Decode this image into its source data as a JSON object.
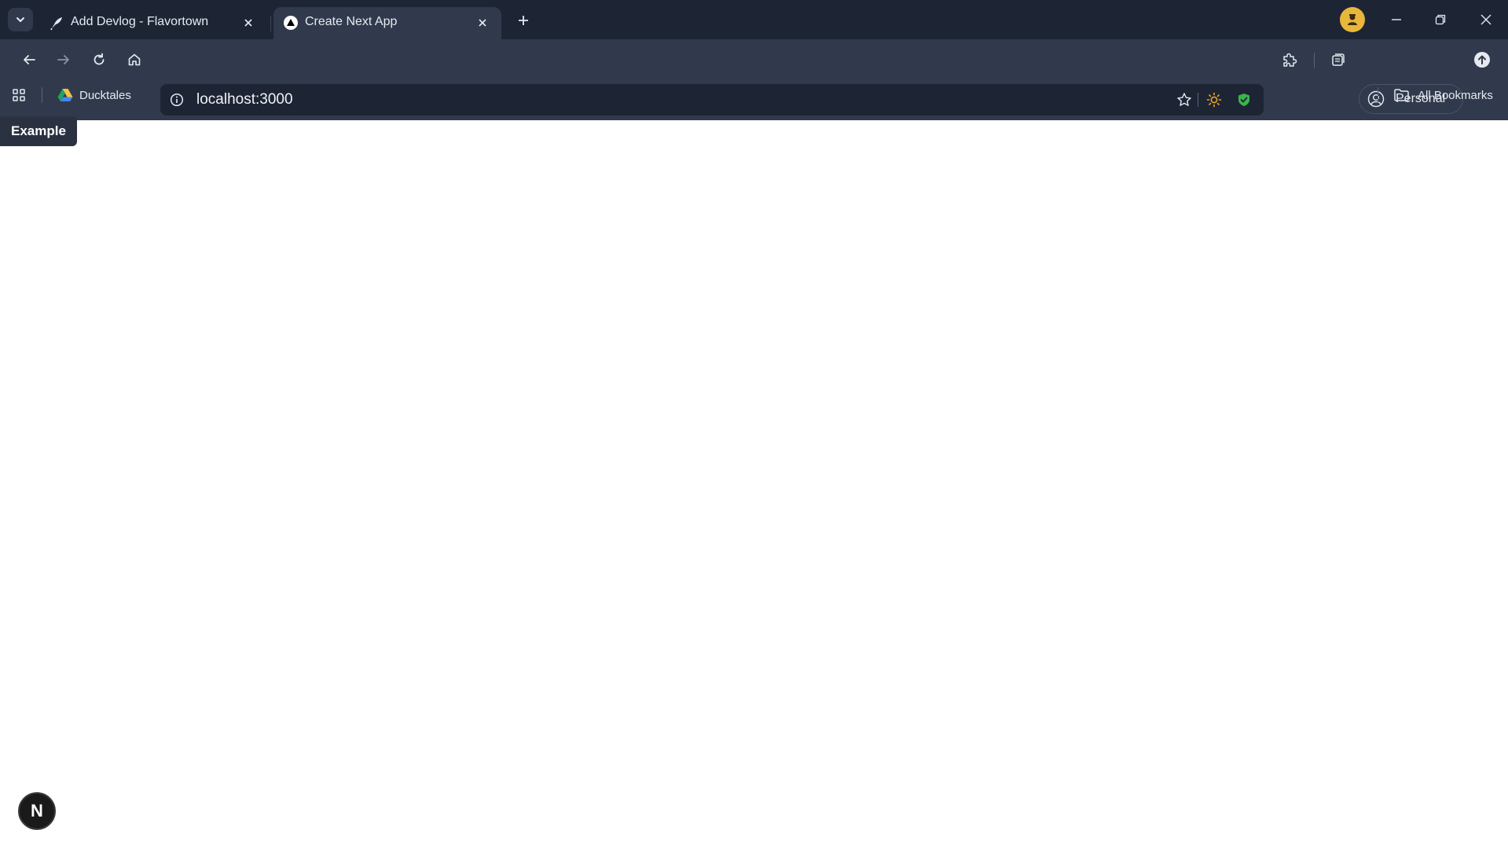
{
  "browser": {
    "tabs": [
      {
        "title": "Add Devlog - Flavortown",
        "active": false
      },
      {
        "title": "Create Next App",
        "active": true
      }
    ],
    "address_bar": {
      "url": "localhost:3000"
    },
    "bookmarks": [
      {
        "label": "Ducktales"
      }
    ],
    "all_bookmarks_label": "All Bookmarks",
    "profile": {
      "label": "Personal"
    }
  },
  "page": {
    "example_badge": "Example",
    "dev_indicator_letter": "N"
  },
  "colors": {
    "titlebar_bg": "#1d2535",
    "toolbar_bg": "#303a4c",
    "page_bg": "#ffffff",
    "shield_green": "#3bb54a",
    "sun_orange": "#f0a020"
  },
  "icons": [
    "tab-search-icon",
    "quill-icon",
    "next-logo-icon",
    "close-icon",
    "new-tab-icon",
    "avatar-icon",
    "minimize-icon",
    "restore-icon",
    "window-close-icon",
    "back-icon",
    "forward-icon",
    "reload-icon",
    "home-icon",
    "info-icon",
    "star-icon",
    "sun-icon",
    "shield-icon",
    "extensions-icon",
    "collections-icon",
    "profile-icon",
    "downloads-icon",
    "apps-icon",
    "drive-icon",
    "folder-icon"
  ]
}
